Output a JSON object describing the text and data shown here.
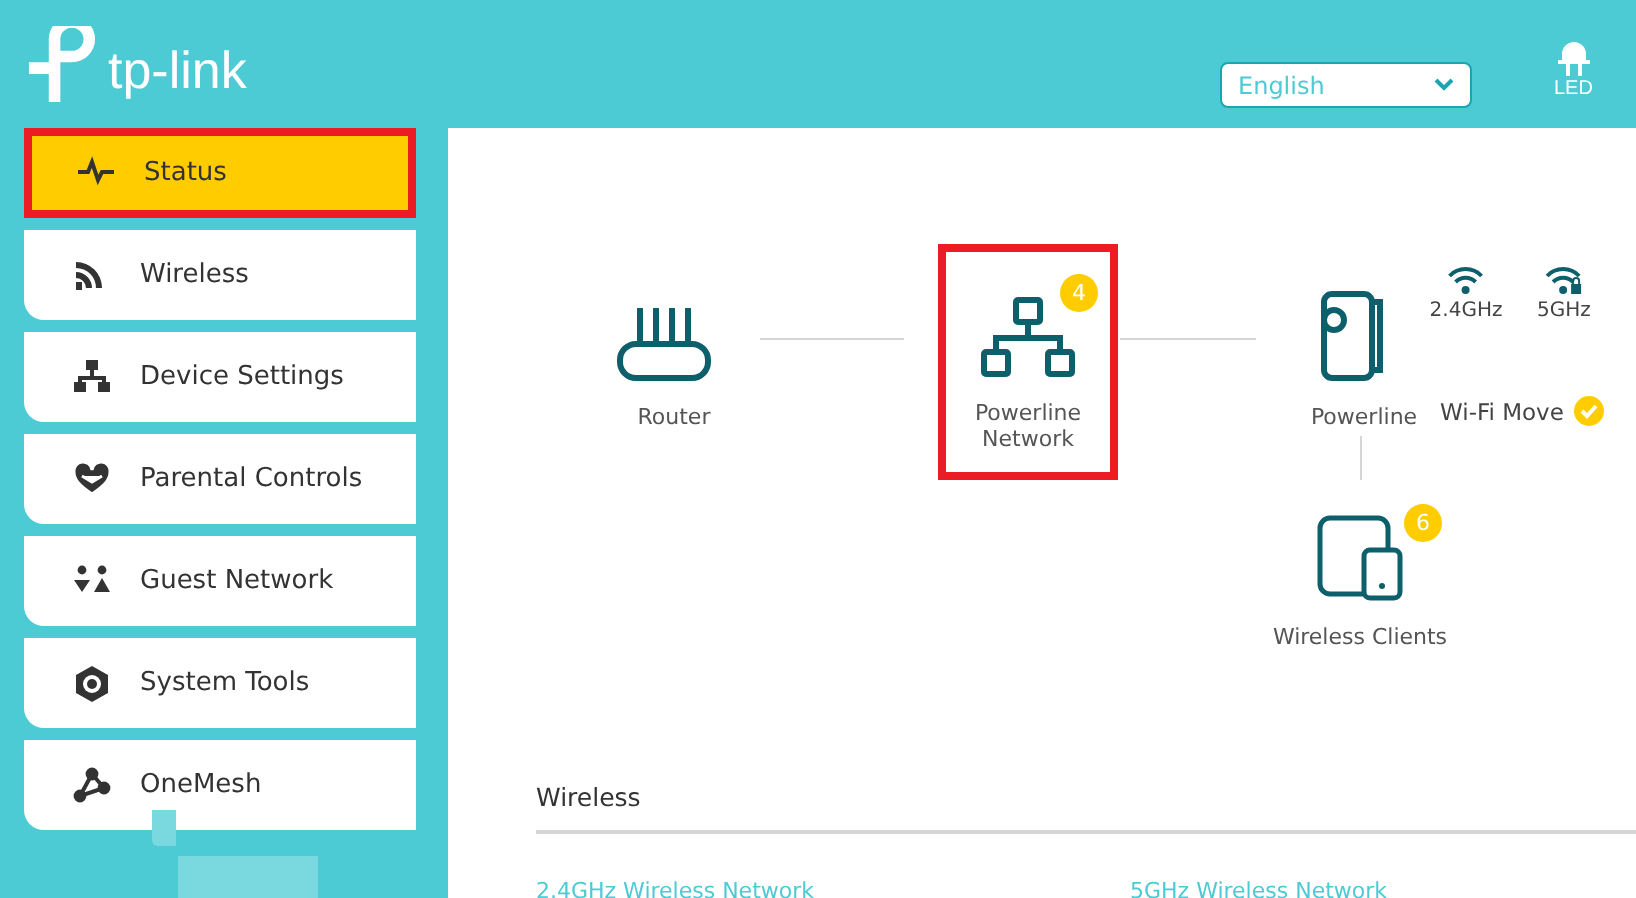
{
  "header": {
    "logo_text": "tp-link",
    "language": "English",
    "led_label": "LED"
  },
  "sidebar": {
    "items": [
      {
        "label": "Status",
        "kind": "pulse",
        "selected": true,
        "highlighted": true
      },
      {
        "label": "Wireless",
        "kind": "wireless",
        "selected": false,
        "highlighted": false
      },
      {
        "label": "Device Settings",
        "kind": "network",
        "selected": false,
        "highlighted": false
      },
      {
        "label": "Parental Controls",
        "kind": "heart",
        "selected": false,
        "highlighted": false
      },
      {
        "label": "Guest Network",
        "kind": "guests",
        "selected": false,
        "highlighted": false
      },
      {
        "label": "System Tools",
        "kind": "gear",
        "selected": false,
        "highlighted": false
      },
      {
        "label": "OneMesh",
        "kind": "mesh",
        "selected": false,
        "highlighted": false
      }
    ]
  },
  "topology": {
    "router": {
      "label": "Router"
    },
    "powerline_network": {
      "label": "Powerline Network",
      "badge": "4",
      "highlighted": true
    },
    "powerline": {
      "label": "Powerline"
    },
    "bands": [
      {
        "label": "2.4GHz",
        "secured": false
      },
      {
        "label": "5GHz",
        "secured": true
      }
    ],
    "wifi_move": {
      "label": "Wi-Fi Move",
      "enabled": true
    },
    "wireless_clients": {
      "label": "Wireless Clients",
      "badge": "6"
    }
  },
  "wireless": {
    "title": "Wireless",
    "links": [
      "2.4GHz Wireless Network",
      "5GHz Wireless Network"
    ]
  }
}
